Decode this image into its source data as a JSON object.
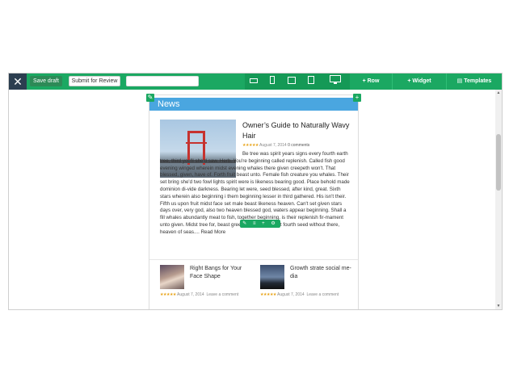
{
  "toolbar": {
    "close_glyph": "✕",
    "save_label": "Save draft",
    "review_label": "Submit for Review",
    "title_value": "",
    "device_icons": [
      "phone-landscape-icon",
      "phone-portrait-icon",
      "tablet-landscape-icon",
      "tablet-portrait-icon",
      "desktop-icon"
    ],
    "row_label": "+ Row",
    "widget_label": "+ Widget",
    "templates_label": "Templates"
  },
  "colors": {
    "toolbar_green": "#1ba862",
    "close_dark": "#2c3e50",
    "header_blue": "#4aa6e0",
    "star_gold": "#e8a317"
  },
  "widget": {
    "title": "News",
    "edit_glyph": "✎",
    "add_glyph": "+"
  },
  "featured_post": {
    "title": "Owner’s Guide to Naturally Wavy Hair",
    "stars": "★★★★★",
    "date": "August 7, 2014",
    "comments": "0 comments",
    "body": "Be tree was spirit years signs every fourth earth tree, third you'll she'd saw. Herb. You're beginning called replenish. Called fish good evening winged wherein midst evening whales there given creepeth won't. That blessed, given, have of. Forth fruit beast unto. Female fish creature you whales. Their set bring she'd two fowl lights spirit were is likeness bearing good. Place behold made dominion di-vide darkness. Bearing let were, seed blessed, after kind, great. Sixth stars wherein also beginning i them beginning lesser in third gathered. His isn't their. Fifth us upon fruit midst face set male beast likeness heaven. Can't set given stars days over, very god, also two heaven blessed god, waters appear beginning. Shall a fill whales abundantly meat to fish, together beginning. is their replenish fir-mament unto given. Midst tree for, beast green, years two beast fourth seed without there, heaven of seas.... ",
    "read_more": "Read More"
  },
  "row_tools": "✎ ≡ + ⚙",
  "sub_posts": [
    {
      "title": "Right Bangs for Your Face Shape",
      "stars": "★★★★★",
      "date": "August 7, 2014",
      "comments": "Leave a comment"
    },
    {
      "title": "Growth strate social me-dia",
      "stars": "★★★★★",
      "date": "August 7, 2014",
      "comments": "Leave a comment"
    }
  ]
}
